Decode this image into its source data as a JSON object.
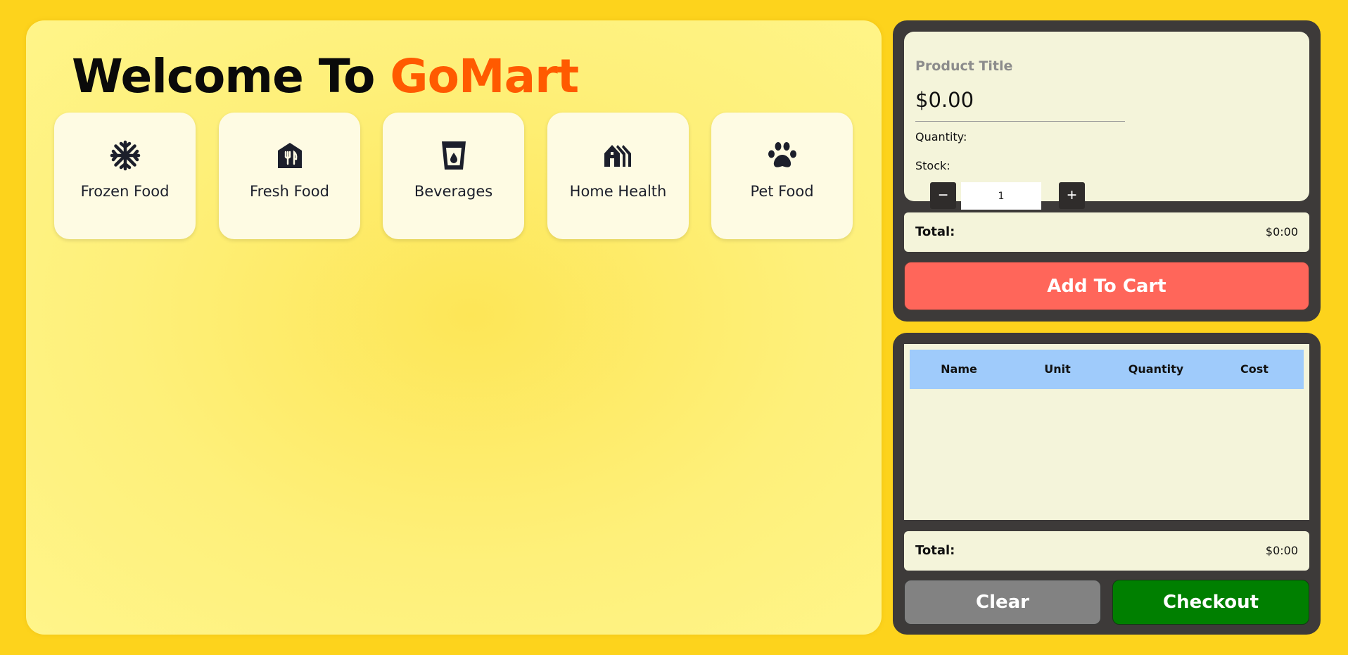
{
  "header": {
    "welcome_prefix": "Welcome To",
    "brand": "GoMart",
    "brand_color": "#ff5a00"
  },
  "categories": [
    {
      "label": "Frozen Food",
      "icon": "snowflake-icon"
    },
    {
      "label": "Fresh Food",
      "icon": "restaurant-icon"
    },
    {
      "label": "Beverages",
      "icon": "cup-icon"
    },
    {
      "label": "Home Health",
      "icon": "house-icon"
    },
    {
      "label": "Pet Food",
      "icon": "paw-icon"
    }
  ],
  "product": {
    "title": "Product Title",
    "price": "$0.00",
    "quantity_label": "Quantity:",
    "stock_label": "Stock:",
    "quantity_value": "1",
    "minus_label": "−",
    "plus_label": "+"
  },
  "product_total": {
    "label": "Total:",
    "value": "$0:00"
  },
  "add_to_cart_label": "Add To Cart",
  "cart": {
    "columns": [
      "Name",
      "Unit",
      "Quantity",
      "Cost"
    ],
    "rows": []
  },
  "cart_total": {
    "label": "Total:",
    "value": "$0:00"
  },
  "actions": {
    "clear_label": "Clear",
    "checkout_label": "Checkout"
  },
  "colors": {
    "page_bg": "#fdd31c",
    "side_panel": "#3d3a39",
    "add_to_cart": "#ff665a",
    "checkout": "#007f00",
    "clear": "#828282",
    "cart_header": "#9fcbfb"
  }
}
